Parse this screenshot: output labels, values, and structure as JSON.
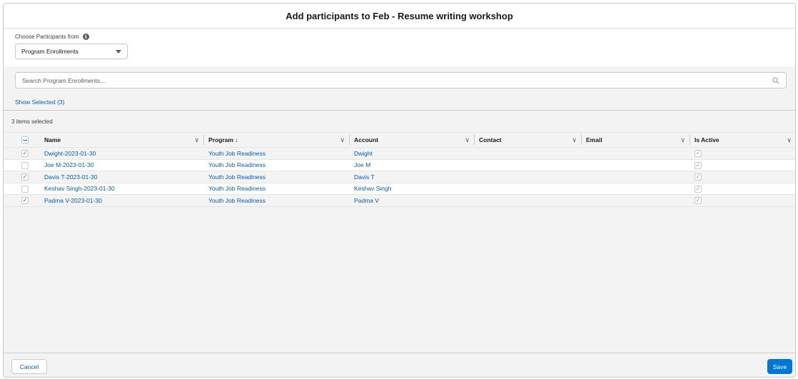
{
  "modal": {
    "title": "Add participants to Feb - Resume writing workshop"
  },
  "source": {
    "label": "Choose Participants from",
    "info_icon": "info-icon",
    "selected": "Program Enrollments"
  },
  "search": {
    "placeholder": "Search Program Enrollments..."
  },
  "show_selected": "Show Selected (3)",
  "items_selected": "3 items selected",
  "table": {
    "columns": [
      {
        "label": "Name"
      },
      {
        "label": "Program ↓"
      },
      {
        "label": "Account"
      },
      {
        "label": "Contact"
      },
      {
        "label": "Email"
      },
      {
        "label": "Is Active"
      }
    ],
    "rows": [
      {
        "name": "Dwight-2023-01-30",
        "program": "Youth Job Readiness",
        "account": "Dwight",
        "contact": "",
        "email": "",
        "selected": true,
        "is_active": true
      },
      {
        "name": "Joe M-2023-01-30",
        "program": "Youth Job Readiness",
        "account": "Joe M",
        "contact": "",
        "email": "",
        "selected": false,
        "is_active": true
      },
      {
        "name": "Davis T-2023-01-30",
        "program": "Youth Job Readiness",
        "account": "Davis T",
        "contact": "",
        "email": "",
        "selected": true,
        "is_active": true
      },
      {
        "name": "Keshav Singh-2023-01-30",
        "program": "Youth Job Readiness",
        "account": "Keshav Singh",
        "contact": "",
        "email": "",
        "selected": false,
        "is_active": true
      },
      {
        "name": "Padma V-2023-01-30",
        "program": "Youth Job Readiness",
        "account": "Padma V",
        "contact": "",
        "email": "",
        "selected": true,
        "is_active": true
      }
    ]
  },
  "footer": {
    "cancel_label": "Cancel",
    "save_label": "Save"
  },
  "colors": {
    "link": "#0b5cab",
    "brand": "#0176d3"
  }
}
